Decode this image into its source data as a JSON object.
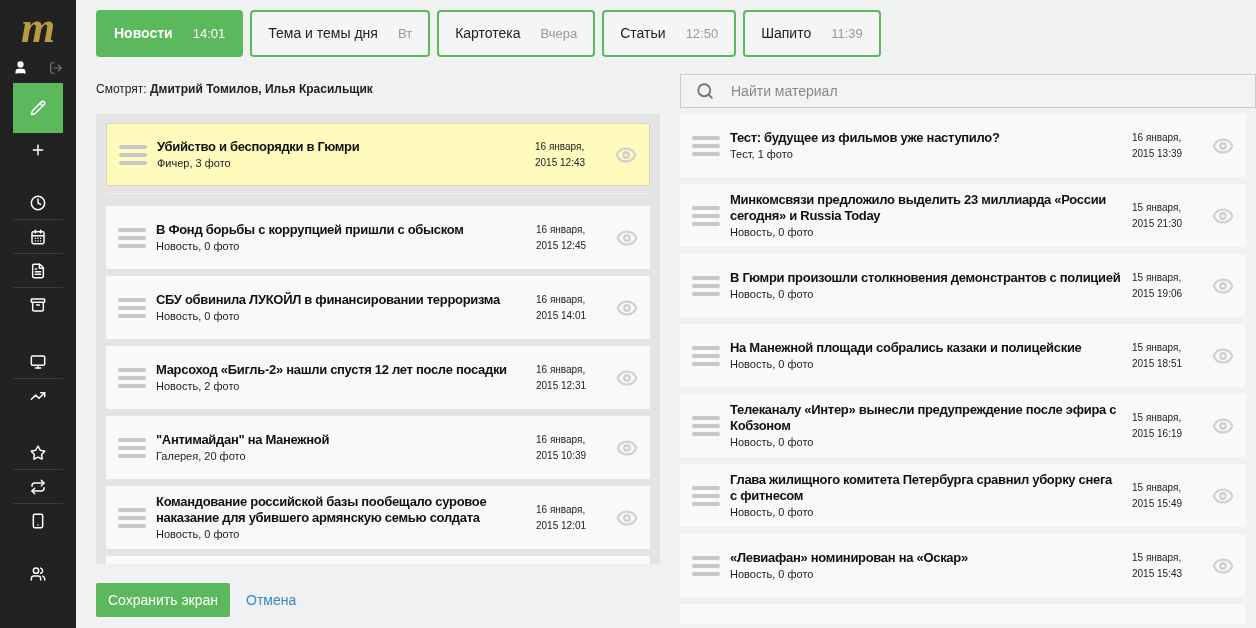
{
  "sidebar": {
    "logo": "m",
    "items": [
      {
        "selected": true
      },
      {
        "selected": false
      },
      {
        "selected": false
      },
      {
        "selected": false
      },
      {
        "selected": false
      },
      {
        "selected": false
      },
      {
        "selected": false
      },
      {
        "selected": false
      },
      {
        "selected": false
      },
      {
        "selected": false
      },
      {
        "selected": false
      },
      {
        "selected": false
      }
    ]
  },
  "tabs": [
    {
      "label": "Новости",
      "time": "14:01",
      "selected": true
    },
    {
      "label": "Тема и темы дня",
      "time": "Вт",
      "selected": false
    },
    {
      "label": "Картотека",
      "time": "Вчера",
      "selected": false
    },
    {
      "label": "Статьи",
      "time": "12:50",
      "selected": false
    },
    {
      "label": "Шапито",
      "time": "11:39",
      "selected": false
    }
  ],
  "viewers": "Смотрят: **Дмитрий Томилов, Илья Красильщик**",
  "screen_list": [
    {
      "title": "Убийство и беспорядки в Гюмри",
      "meta": "Фичер, 3 фото",
      "date": "16 января,",
      "time": "2015 12:43",
      "selected": true
    },
    {
      "title": "В Фонд борьбы с коррупцией пришли с обыском",
      "meta": "Новость, 0 фото",
      "date": "16 января,",
      "time": "2015 12:45",
      "selected": false
    },
    {
      "title": "СБУ обвинила ЛУКОЙЛ в финансировании терроризма",
      "meta": "Новость, 0 фото",
      "date": "16 января,",
      "time": "2015 14:01",
      "selected": false
    },
    {
      "title": "Марсоход «Бигль-2» нашли спустя 12 лет после посадки",
      "meta": "Новость, 2 фото",
      "date": "16 января,",
      "time": "2015 12:31",
      "selected": false
    },
    {
      "title": "\"Антимайдан\" на Манежной",
      "meta": "Галерея, 20 фото",
      "date": "16 января,",
      "time": "2015 10:39",
      "selected": false
    },
    {
      "title": "Командование российской базы пообещало суровое наказание для убившего армянскую семью солдата",
      "meta": "Новость, 0 фото",
      "date": "16 января,",
      "time": "2015 12:01",
      "selected": false
    }
  ],
  "save_button": "Сохранить экран",
  "cancel_link": "Отмена",
  "search": {
    "placeholder": "Найти материал"
  },
  "materials": [
    {
      "title": "Тест: будущее из фильмов уже наступило?",
      "meta": "Тест, 1 фото",
      "date": "16 января,",
      "time": "2015 13:39"
    },
    {
      "title": "Минкомсвязи предложило выделить 23 миллиарда «России сегодня» и Russia Today",
      "meta": "Новость, 0 фото",
      "date": "15 января,",
      "time": "2015 21:30"
    },
    {
      "title": "В Гюмри произошли столкновения демонстрантов с полицией",
      "meta": "Новость, 0 фото",
      "date": "15 января,",
      "time": "2015 19:06"
    },
    {
      "title": "На Манежной площади собрались казаки и полицейские",
      "meta": "Новость, 0 фото",
      "date": "15 января,",
      "time": "2015 18:51"
    },
    {
      "title": "Телеканалу «Интер» вынесли предупреждение после эфира с Кобзоном",
      "meta": "Новость, 0 фото",
      "date": "15 января,",
      "time": "2015 16:19"
    },
    {
      "title": "Глава жилищного комитета Петербурга сравнил уборку снега с фитнесом",
      "meta": "Новость, 0 фото",
      "date": "15 января,",
      "time": "2015 15:49"
    },
    {
      "title": "«Левиафан» номинирован на «Оскар»",
      "meta": "Новость, 0 фото",
      "date": "15 января,",
      "time": "2015 15:43"
    }
  ]
}
